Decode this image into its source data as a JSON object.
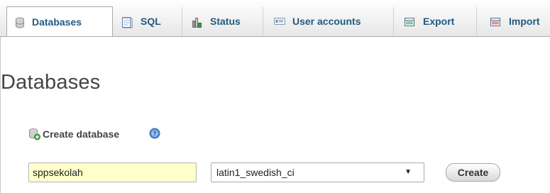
{
  "tabs": [
    {
      "label": "Databases",
      "icon": "database-icon",
      "active": true
    },
    {
      "label": "SQL",
      "icon": "sql-icon",
      "active": false
    },
    {
      "label": "Status",
      "icon": "status-icon",
      "active": false
    },
    {
      "label": "User accounts",
      "icon": "user-accounts-icon",
      "active": false
    },
    {
      "label": "Export",
      "icon": "export-icon",
      "active": false
    },
    {
      "label": "Import",
      "icon": "import-icon",
      "active": false
    }
  ],
  "page": {
    "title": "Databases"
  },
  "create_database": {
    "heading": "Create database",
    "name_value": "sppsekolah",
    "collation_selected": "latin1_swedish_ci",
    "button_label": "Create"
  },
  "colors": {
    "tab_text": "#235a81",
    "input_bg": "#ffffcc"
  }
}
